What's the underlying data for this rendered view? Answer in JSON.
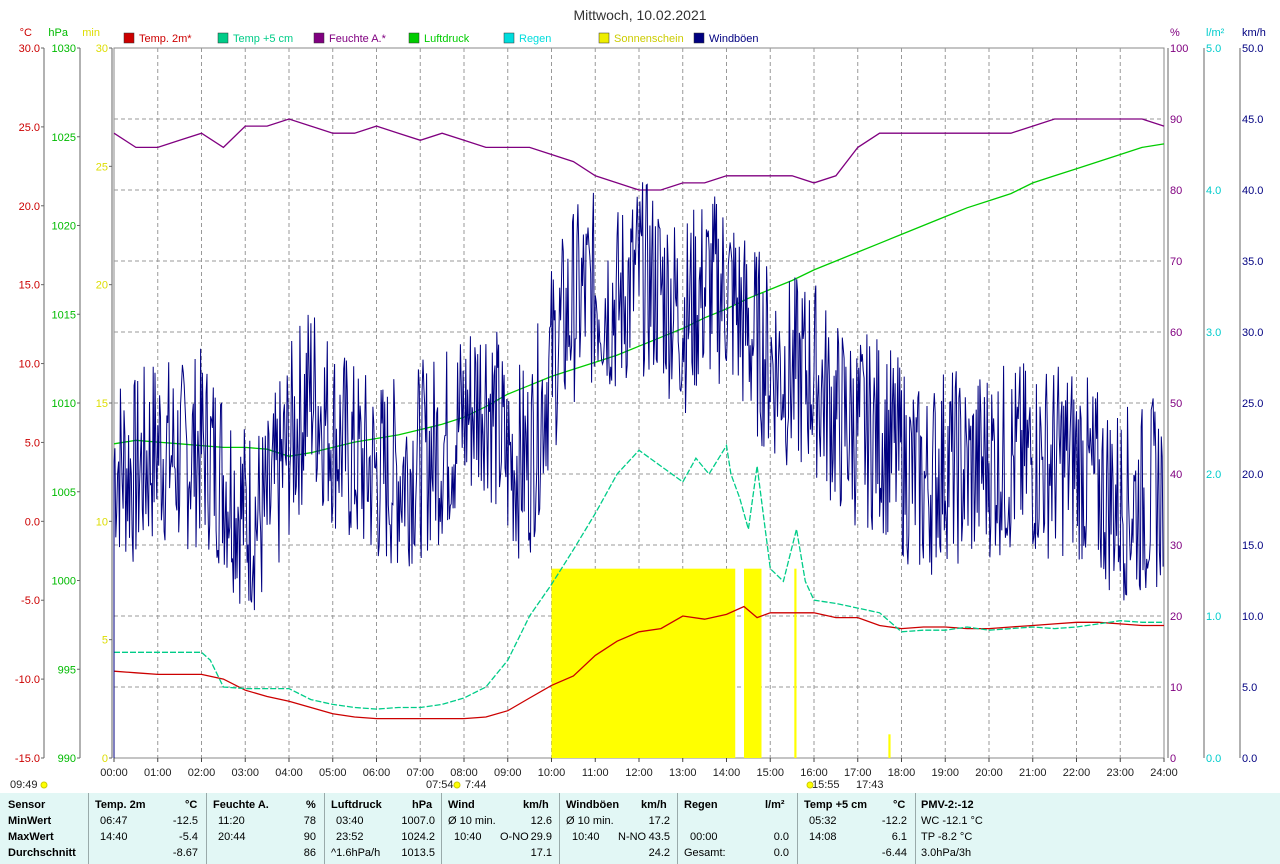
{
  "chart_data": {
    "type": "line",
    "title": "Mittwoch, 10.02.2021",
    "x_ticks": [
      "00:00",
      "01:00",
      "02:00",
      "03:00",
      "04:00",
      "05:00",
      "06:00",
      "07:00",
      "08:00",
      "09:00",
      "10:00",
      "11:00",
      "12:00",
      "13:00",
      "14:00",
      "15:00",
      "16:00",
      "17:00",
      "18:00",
      "19:00",
      "20:00",
      "21:00",
      "22:00",
      "23:00",
      "24:00"
    ],
    "axes": {
      "temp": {
        "unit": "°C",
        "color": "#cc0000",
        "range": [
          -15,
          30
        ],
        "ticks": [
          "30.0",
          "25.0",
          "20.0",
          "15.0",
          "10.0",
          "5.0",
          "0.0",
          "-5.0",
          "-10.0",
          "-15.0"
        ]
      },
      "pressure": {
        "unit": "hPa",
        "color": "#00bb00",
        "range": [
          990,
          1030
        ],
        "ticks": [
          "1030",
          "1025",
          "1020",
          "1015",
          "1010",
          "1005",
          "1000",
          "995",
          "990"
        ]
      },
      "sunshine": {
        "unit": "min",
        "color": "#dddd00",
        "range": [
          0,
          30
        ],
        "ticks": [
          "30",
          "25",
          "20",
          "15",
          "10",
          "5",
          "0"
        ]
      },
      "humidity": {
        "unit": "%",
        "color": "#800080",
        "range": [
          0,
          100
        ],
        "ticks": [
          "100",
          "90",
          "80",
          "70",
          "60",
          "50",
          "40",
          "30",
          "20",
          "10",
          "0"
        ]
      },
      "rain": {
        "unit": "l/m²",
        "color": "#00cccc",
        "range": [
          0,
          5
        ],
        "ticks": [
          "5.0",
          "4.0",
          "3.0",
          "2.0",
          "1.0",
          "0.0"
        ]
      },
      "wind": {
        "unit": "km/h",
        "color": "#000080",
        "range": [
          0,
          50
        ],
        "ticks": [
          "50.0",
          "45.0",
          "40.0",
          "35.0",
          "30.0",
          "25.0",
          "20.0",
          "15.0",
          "10.0",
          "5.0",
          "0.0"
        ]
      }
    },
    "legend": [
      {
        "name": "Temp. 2m*",
        "color": "#cc0000"
      },
      {
        "name": "Temp +5 cm",
        "color": "#00cc88"
      },
      {
        "name": "Feuchte A.*",
        "color": "#800080"
      },
      {
        "name": "Luftdruck",
        "color": "#00cc00"
      },
      {
        "name": "Regen",
        "color": "#00dddd"
      },
      {
        "name": "Sonnenschein",
        "color": "#eeee00"
      },
      {
        "name": "Windböen",
        "color": "#000080"
      }
    ],
    "series": [
      {
        "name": "Temp. 2m*",
        "axis": "temp",
        "color": "#cc0000",
        "x": [
          0,
          0.5,
          1,
          1.5,
          2,
          2.5,
          3,
          3.5,
          4,
          4.5,
          5,
          5.5,
          6,
          6.5,
          7,
          7.5,
          8,
          8.5,
          9,
          9.5,
          10,
          10.5,
          11,
          11.5,
          12,
          12.5,
          13,
          13.5,
          14,
          14.4,
          14.7,
          15,
          15.5,
          16,
          16.5,
          17,
          17.5,
          18,
          18.5,
          19,
          19.5,
          20,
          20.5,
          21,
          21.5,
          22,
          22.5,
          23,
          23.5,
          24
        ],
        "y": [
          -9.5,
          -9.6,
          -9.7,
          -9.7,
          -9.7,
          -10,
          -10.7,
          -11.1,
          -11.4,
          -11.8,
          -12.2,
          -12.4,
          -12.5,
          -12.5,
          -12.5,
          -12.5,
          -12.5,
          -12.4,
          -12.0,
          -11.2,
          -10.4,
          -9.8,
          -8.5,
          -7.6,
          -7.0,
          -6.8,
          -6.0,
          -6.2,
          -5.9,
          -5.4,
          -6.1,
          -5.8,
          -5.8,
          -5.8,
          -6.1,
          -6.1,
          -6.6,
          -6.8,
          -6.7,
          -6.7,
          -6.8,
          -6.8,
          -6.7,
          -6.6,
          -6.5,
          -6.4,
          -6.4,
          -6.5,
          -6.6,
          -6.6
        ]
      },
      {
        "name": "Temp +5 cm",
        "axis": "temp",
        "color": "#00cc88",
        "x": [
          0,
          0.5,
          1,
          1.5,
          2,
          2.2,
          2.5,
          3,
          3.5,
          4,
          4.5,
          5,
          5.5,
          6,
          6.5,
          7,
          7.5,
          8,
          8.5,
          9,
          9.5,
          10,
          10.5,
          11,
          11.5,
          12,
          12.5,
          13,
          13.3,
          13.6,
          14,
          14.1,
          14.3,
          14.5,
          14.7,
          15,
          15.3,
          15.6,
          15.8,
          16,
          16.5,
          17,
          17.5,
          18,
          18.5,
          19,
          19.5,
          20,
          20.5,
          21,
          21.5,
          22,
          22.5,
          23,
          23.5,
          24
        ],
        "y": [
          -8.3,
          -8.3,
          -8.3,
          -8.3,
          -8.3,
          -8.8,
          -10.5,
          -10.6,
          -10.6,
          -10.6,
          -11.3,
          -11.6,
          -11.8,
          -11.9,
          -11.8,
          -11.8,
          -11.6,
          -11.2,
          -10.5,
          -8.8,
          -6.0,
          -4.0,
          -1.8,
          0.5,
          3.0,
          4.5,
          3.5,
          2.5,
          4.0,
          3.0,
          4.8,
          3.0,
          1.5,
          -0.5,
          3.5,
          -3.0,
          -3.8,
          -0.5,
          -3.8,
          -5.0,
          -5.2,
          -5.5,
          -5.8,
          -7.0,
          -6.9,
          -6.9,
          -6.7,
          -6.9,
          -6.8,
          -6.7,
          -6.8,
          -6.7,
          -6.5,
          -6.3,
          -6.4,
          -6.4
        ]
      },
      {
        "name": "Feuchte A.*",
        "axis": "humidity",
        "color": "#800080",
        "x": [
          0,
          0.5,
          1,
          1.5,
          2,
          2.5,
          3,
          3.5,
          4,
          4.5,
          5,
          5.5,
          6,
          6.5,
          7,
          7.5,
          8,
          8.5,
          9,
          9.5,
          10,
          10.5,
          11,
          11.5,
          12,
          12.5,
          13,
          13.5,
          14,
          14.5,
          15,
          15.5,
          16,
          16.5,
          17,
          17.5,
          18,
          18.5,
          19,
          19.5,
          20,
          20.5,
          21,
          21.5,
          22,
          22.5,
          23,
          23.5,
          24
        ],
        "y": [
          88,
          86,
          86,
          87,
          88,
          86,
          89,
          89,
          90,
          89,
          88,
          88,
          89,
          88,
          87,
          88,
          87,
          86,
          86,
          86,
          85,
          84,
          82,
          81,
          80,
          80,
          81,
          81,
          82,
          82,
          82,
          82,
          81,
          82,
          86,
          88,
          88,
          88,
          88,
          88,
          88,
          88,
          89,
          90,
          90,
          90,
          90,
          90,
          89
        ]
      },
      {
        "name": "Luftdruck",
        "axis": "pressure",
        "color": "#00cc00",
        "x": [
          0,
          0.5,
          1,
          1.5,
          2,
          2.5,
          3,
          3.5,
          4,
          4.5,
          5,
          5.5,
          6,
          6.5,
          7,
          7.5,
          8,
          8.5,
          9,
          9.5,
          10,
          10.5,
          11,
          11.5,
          12,
          12.5,
          13,
          13.5,
          14,
          14.5,
          15,
          15.5,
          16,
          16.5,
          17,
          17.5,
          18,
          18.5,
          19,
          19.5,
          20,
          20.5,
          21,
          21.5,
          22,
          22.5,
          23,
          23.5,
          24
        ],
        "y": [
          1007.7,
          1007.9,
          1007.8,
          1007.7,
          1007.6,
          1007.5,
          1007.5,
          1007.4,
          1007.0,
          1007.2,
          1007.5,
          1007.8,
          1008.0,
          1008.2,
          1008.5,
          1008.8,
          1009.2,
          1009.8,
          1010.5,
          1011.0,
          1011.5,
          1011.9,
          1012.3,
          1012.7,
          1013.2,
          1013.7,
          1014.2,
          1014.8,
          1015.3,
          1015.9,
          1016.4,
          1016.9,
          1017.5,
          1018.0,
          1018.5,
          1019.0,
          1019.5,
          1020.0,
          1020.5,
          1021.0,
          1021.4,
          1021.8,
          1022.4,
          1022.8,
          1023.2,
          1023.6,
          1024.0,
          1024.4,
          1024.6
        ]
      },
      {
        "name": "Windböen",
        "axis": "wind",
        "color": "#000080",
        "gusty": true,
        "x": [
          0,
          0.5,
          1,
          1.5,
          2,
          2.5,
          3,
          3.5,
          4,
          4.5,
          5,
          5.5,
          6,
          6.5,
          7,
          7.5,
          8,
          8.5,
          9,
          9.5,
          10,
          10.5,
          11,
          11.5,
          12,
          12.5,
          13,
          13.5,
          14,
          14.5,
          15,
          15.5,
          16,
          16.5,
          17,
          17.5,
          18,
          18.5,
          19,
          19.5,
          20,
          20.5,
          21,
          21.5,
          22,
          22.5,
          23,
          23.5,
          24
        ],
        "y": [
          21,
          20,
          22,
          21,
          22,
          20,
          17,
          17,
          22,
          26,
          23,
          21,
          20,
          20,
          21,
          22,
          24,
          26,
          21,
          21,
          28,
          32,
          33,
          32,
          34,
          33,
          31,
          33,
          33,
          30,
          28,
          27,
          27,
          24,
          23,
          23,
          21,
          19,
          21,
          20,
          21,
          21,
          21,
          21,
          21,
          19,
          18,
          18,
          19
        ]
      }
    ],
    "sunshine_blocks": [
      {
        "from": 10.0,
        "to": 14.2,
        "minutes": 8
      },
      {
        "from": 14.4,
        "to": 14.8,
        "minutes": 8
      },
      {
        "from": 15.55,
        "to": 15.6,
        "minutes": 8
      },
      {
        "from": 17.7,
        "to": 17.75,
        "minutes": 1
      }
    ],
    "markers": {
      "sunrise": "07:54",
      "sunrise_alt": "7:44",
      "sunset": "15:55",
      "sunset_alt": "17:43",
      "corner": "09:49"
    }
  },
  "summary": {
    "sensor": {
      "header": "Sensor",
      "rows": [
        "MinWert",
        "MaxWert",
        "Durchschnitt"
      ]
    },
    "temp2m": {
      "header": "Temp. 2m",
      "unit": "°C",
      "rows": [
        [
          "06:47",
          "-12.5"
        ],
        [
          "14:40",
          "-5.4"
        ],
        [
          "",
          "-8.67"
        ]
      ]
    },
    "humidity": {
      "header": "Feuchte A.",
      "unit": "%",
      "rows": [
        [
          "11:20",
          "78"
        ],
        [
          "20:44",
          "90"
        ],
        [
          "",
          "86"
        ]
      ]
    },
    "pressure": {
      "header": "Luftdruck",
      "unit": "hPa",
      "rows": [
        [
          "03:40",
          "1007.0"
        ],
        [
          "23:52",
          "1024.2"
        ],
        [
          "^1.6hPa/h",
          "1013.5"
        ]
      ]
    },
    "wind": {
      "header": "Wind",
      "unit": "km/h",
      "rows": [
        [
          "Ø 10 min.",
          "",
          "12.6"
        ],
        [
          "10:40",
          "O-NO",
          "29.9"
        ],
        [
          "",
          "",
          "17.1"
        ]
      ]
    },
    "gusts": {
      "header": "Windböen",
      "unit": "km/h",
      "rows": [
        [
          "Ø 10 min.",
          "",
          "17.2"
        ],
        [
          "10:40",
          "N-NO",
          "43.5"
        ],
        [
          "",
          "",
          "24.2"
        ]
      ]
    },
    "rain": {
      "header": "Regen",
      "unit": "l/m²",
      "rows": [
        [
          "",
          ""
        ],
        [
          "00:00",
          "0.0"
        ],
        [
          "Gesamt:",
          "0.0"
        ]
      ]
    },
    "temp5cm": {
      "header": "Temp +5 cm",
      "unit": "°C",
      "rows": [
        [
          "05:32",
          "-12.2"
        ],
        [
          "14:08",
          "6.1"
        ],
        [
          "",
          "-6.44"
        ]
      ]
    },
    "pmv": {
      "header": "PMV-2:-12",
      "rows": [
        "WC -12.1 °C",
        "TP -8.2 °C",
        "3.0hPa/3h"
      ]
    }
  }
}
